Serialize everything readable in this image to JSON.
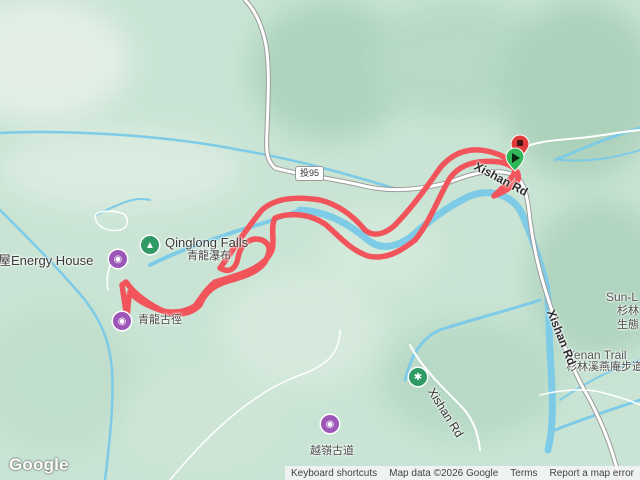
{
  "map": {
    "labels": {
      "energy_house": "屋Energy House",
      "qinglong_falls": "Qinglong Falls",
      "qinglong_falls_zh": "青龍瀑布",
      "poi_bottom_left": "青龍古徑",
      "yuelingdao": "越嶺古道",
      "sun_link": "Sun-L",
      "sun_link_zh1": "杉林",
      "sun_link_zh2": "生態",
      "yenan_trail": "Yenan Trail",
      "yenan_trail_zh": "杉林溪燕庵步道",
      "xishan_rd_top": "Xishan Rd",
      "xishan_rd_right": "Xishan Rd",
      "xishan_rd_bottom": "Xishan Rd",
      "route_shield": "投95"
    },
    "icons": {
      "tree": "tree-icon",
      "camera": "camera-icon",
      "hiker": "hiker-icon",
      "start": "start-flag-icon",
      "end": "end-flag-icon"
    },
    "colors": {
      "track": "#f2545b",
      "river": "#7dcbe7",
      "poi_purple": "#9c56b8",
      "poi_green": "#2f9a63"
    }
  },
  "branding": {
    "logo": "Google"
  },
  "attribution": {
    "shortcuts": "Keyboard shortcuts",
    "data": "Map data ©2026 Google",
    "terms": "Terms",
    "report": "Report a map error"
  }
}
